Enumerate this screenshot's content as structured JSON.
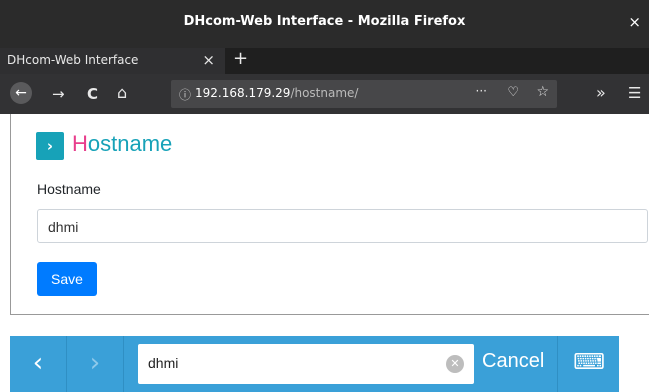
{
  "window": {
    "title": "DHcom-Web Interface - Mozilla Firefox",
    "close": "×"
  },
  "tab": {
    "label": "DHcom-Web Interface",
    "close": "×",
    "new": "+"
  },
  "nav": {
    "back": "←",
    "forward": "→",
    "reload": "C",
    "home": "⌂",
    "url_host": "192.168.179.29",
    "url_path": "/hostname/",
    "info_icon": "ⓘ",
    "dots": "···",
    "pocket": "♡",
    "star": "☆",
    "overflow": "»",
    "menu": "☰"
  },
  "page": {
    "chevron": "›",
    "heading_first": "H",
    "heading_rest": "ostname",
    "field_label": "Hostname",
    "field_value": "dhmi",
    "save_label": "Save"
  },
  "keyboard_bar": {
    "back": "‹",
    "forward": "›",
    "search_value": "dhmi",
    "clear": "✕",
    "cancel": "Cancel",
    "keyboard_icon": "⌨"
  },
  "colors": {
    "accent": "#17a2b8",
    "heading_first": "#e83e8c",
    "primary_button": "#007bff",
    "keyboard_bar": "#3aa0d8"
  }
}
